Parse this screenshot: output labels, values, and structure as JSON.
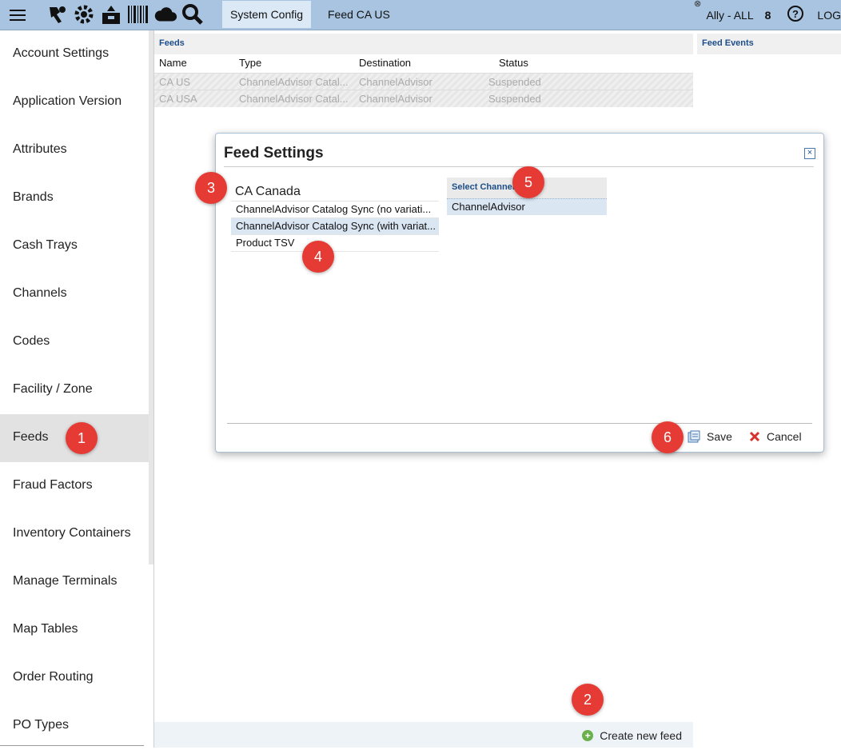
{
  "topbar": {
    "tabs": [
      "System Config",
      "Feed CA US"
    ],
    "user": "Ally - ALL",
    "count": "8",
    "logout": "LOG",
    "icons": [
      "menu-icon",
      "shipping-icon",
      "settings-icon",
      "package-icon",
      "barcode-icon",
      "cloud-icon",
      "search-icon",
      "help-icon"
    ]
  },
  "sidebar": {
    "items": [
      "Account Settings",
      "Application Version",
      "Attributes",
      "Brands",
      "Cash Trays",
      "Channels",
      "Codes",
      "Facility / Zone",
      "Feeds",
      "Fraud Factors",
      "Inventory Containers",
      "Manage Terminals",
      "Map Tables",
      "Order Routing",
      "PO Types"
    ],
    "active": "Feeds"
  },
  "feeds": {
    "title": "Feeds",
    "columns": [
      "Name",
      "Type",
      "Destination",
      "Status"
    ],
    "rows": [
      {
        "name": "CA US",
        "type": "ChannelAdvisor Catal...",
        "destination": "ChannelAdvisor",
        "status": "Suspended"
      },
      {
        "name": "CA USA",
        "type": "ChannelAdvisor Catal...",
        "destination": "ChannelAdvisor",
        "status": "Suspended"
      }
    ],
    "create_label": "Create new feed"
  },
  "events": {
    "title": "Feed Events"
  },
  "dialog": {
    "title": "Feed Settings",
    "feed_name": "CA Canada",
    "types": [
      "ChannelAdvisor Catalog Sync (no variati...",
      "ChannelAdvisor Catalog Sync (with variat...",
      "Product TSV"
    ],
    "selected_type_index": 1,
    "channel_header": "Select Channel",
    "channel_selected": "ChannelAdvisor",
    "save_label": "Save",
    "cancel_label": "Cancel"
  },
  "badges": [
    "1",
    "2",
    "3",
    "4",
    "5",
    "6"
  ],
  "colors": {
    "topbar": "#a9c4e0",
    "badge": "#e53b34",
    "header_text": "#1d4e89"
  }
}
